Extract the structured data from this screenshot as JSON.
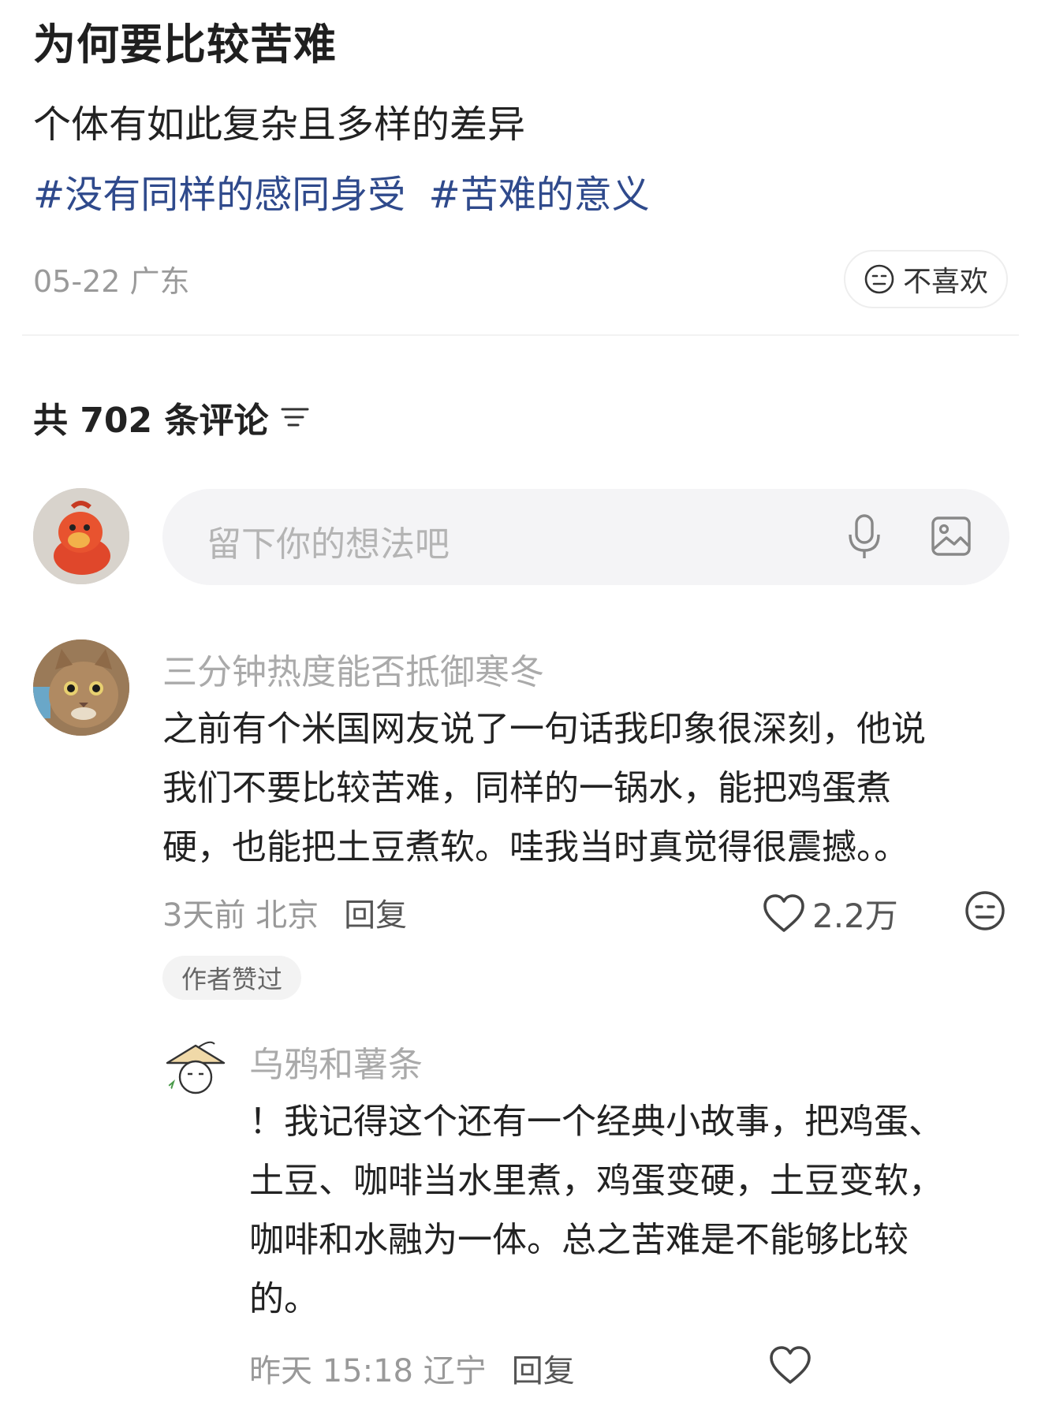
{
  "post": {
    "title": "为何要比较苦难",
    "body": "个体有如此复杂且多样的差异",
    "hashtags": [
      "#没有同样的感同身受",
      "#苦难的意义"
    ],
    "date_location": "05-22 广东",
    "dislike_label": "不喜欢"
  },
  "comments_header": {
    "count_label": "共 702 条评论"
  },
  "comment_input": {
    "placeholder": "留下你的想法吧"
  },
  "comments": [
    {
      "username": "三分钟热度能否抵御寒冬",
      "lines": [
        "之前有个米国网友说了一句话我印象很深刻，他说",
        "我们不要比较苦难，同样的一锅水，能把鸡蛋煮",
        "硬，也能把土豆煮软。哇我当时真觉得很震撼。。"
      ],
      "time_location": "3天前 北京",
      "reply_label": "回复",
      "likes": "2.2万",
      "badge": "作者赞过"
    },
    {
      "username": "乌鸦和薯条",
      "lines": [
        "！我记得这个还有一个经典小故事，把鸡蛋、",
        "土豆、咖啡当水里煮，鸡蛋变硬，土豆变软，",
        "咖啡和水融为一体。总之苦难是不能够比较",
        "的。"
      ],
      "time_location": "昨天 15:18 辽宁",
      "reply_label": "回复"
    }
  ],
  "colors": {
    "hashtag": "#2f4a8c",
    "muted": "#999999",
    "input_bg": "#f4f4f6"
  },
  "icons": [
    "neutral-face-icon",
    "sort-icon",
    "mic-icon",
    "image-icon",
    "heart-icon",
    "avatar"
  ]
}
